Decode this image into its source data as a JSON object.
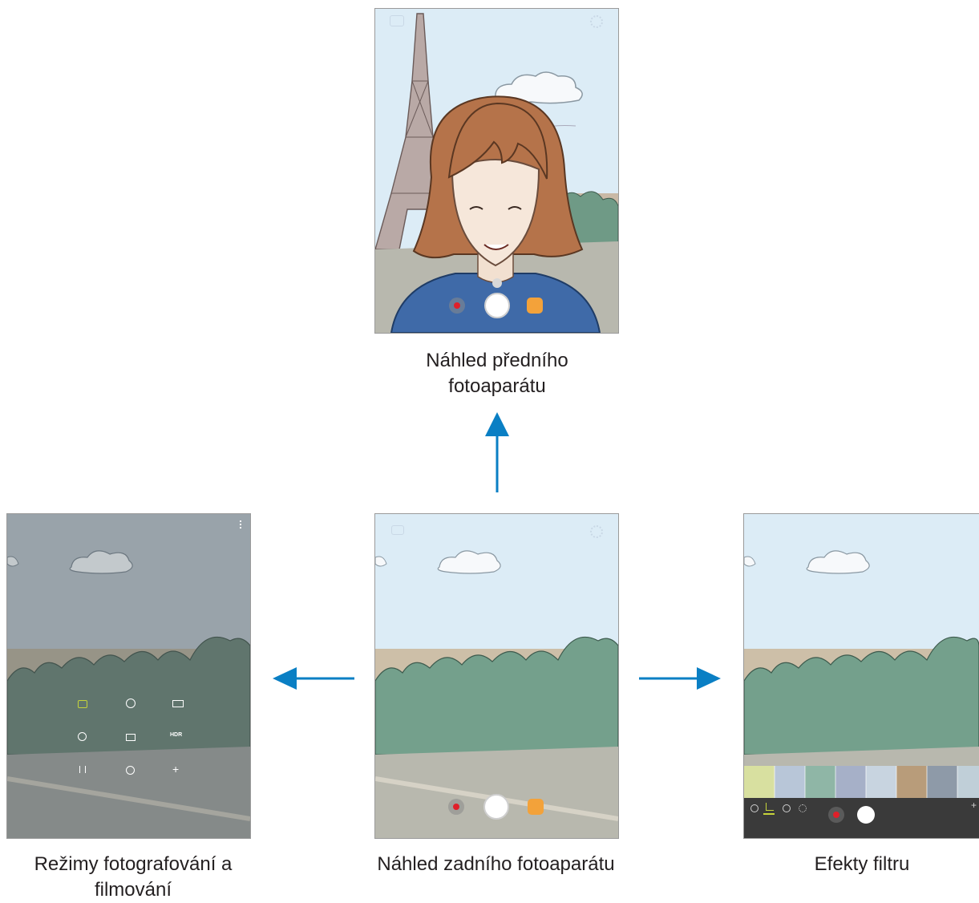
{
  "captions": {
    "front": [
      "Náhled předního",
      "fotoaparátu"
    ],
    "rear": "Náhled zadního fotoaparátu",
    "modes": [
      "Režimy fotografování a",
      "filmování"
    ],
    "filters": "Efekty filtru"
  },
  "mode_icons": [
    "HDR"
  ],
  "colors": {
    "arrow": "#0a7fc4",
    "sky": "#dcecf6",
    "record_dot": "#e0202a",
    "sticker_button": "#f3a23a",
    "filter_panel": "#3a3a3a",
    "filter_tab_active": "#c6d43a"
  }
}
